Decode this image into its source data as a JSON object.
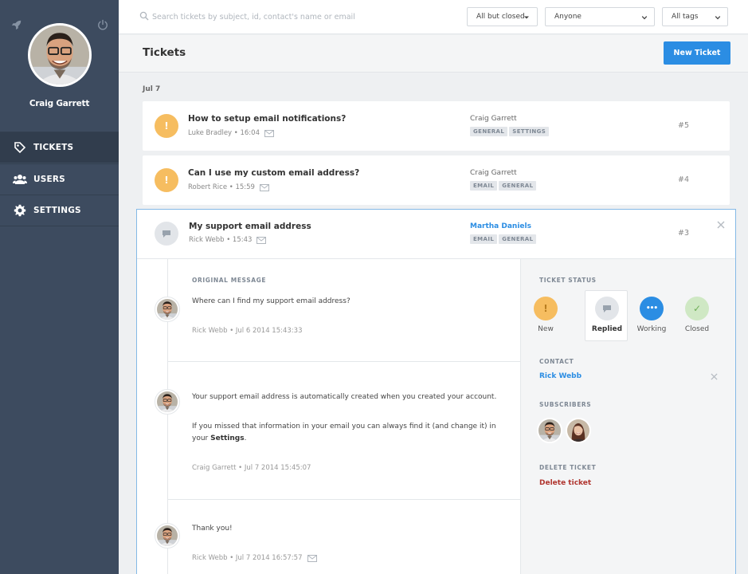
{
  "user": {
    "name": "Craig Garrett"
  },
  "nav": [
    {
      "label": "TICKETS",
      "icon": "tag-icon"
    },
    {
      "label": "USERS",
      "icon": "users-icon"
    },
    {
      "label": "SETTINGS",
      "icon": "gear-icon"
    }
  ],
  "search": {
    "placeholder": "Search tickets by subject, id, contact's name or email"
  },
  "filters": {
    "status": "All but closed",
    "assignee": "Anyone",
    "tags": "All tags"
  },
  "header": {
    "title": "Tickets",
    "new_ticket_label": "New Ticket"
  },
  "date_group": "Jul 7",
  "tickets": [
    {
      "title": "How to setup email notifications?",
      "meta": "Luke Bradley • 16:04",
      "assignee": "Craig Garrett",
      "tags": [
        "GENERAL",
        "SETTINGS"
      ],
      "number": "#5",
      "status": "!"
    },
    {
      "title": "Can I use my custom email address?",
      "meta": "Robert Rice • 15:59",
      "assignee": "Craig Garrett",
      "tags": [
        "EMAIL",
        "GENERAL"
      ],
      "number": "#4",
      "status": "!"
    }
  ],
  "expanded": {
    "title": "My support email address",
    "meta": "Rick Webb • 15:43",
    "assignee": "Martha Daniels",
    "tags": [
      "EMAIL",
      "GENERAL"
    ],
    "number": "#3",
    "messages": [
      {
        "label": "ORIGINAL MESSAGE",
        "paragraphs": [
          "Where can I find my support email address?"
        ],
        "footer": "Rick Webb • Jul 6 2014 15:43:33"
      },
      {
        "paragraphs": [
          "Your support email address is automatically created when you created your account.",
          "If you missed that information in your email you can always find it (and change it) in your "
        ],
        "bold_word": "Settings",
        "after_bold": ".",
        "footer": "Craig Garrett • Jul 7 2014 15:45:07"
      },
      {
        "paragraphs": [
          "Thank you!"
        ],
        "footer": "Rick Webb • Jul 7 2014 16:57:57"
      }
    ],
    "side": {
      "status_label": "TICKET STATUS",
      "statuses": [
        {
          "label": "New",
          "symbol": "!",
          "color": "#f6bd60"
        },
        {
          "label": "Replied",
          "symbol": "",
          "color": "#e2e5e9"
        },
        {
          "label": "Working",
          "symbol": "•••",
          "color": "#2b8de3"
        },
        {
          "label": "Closed",
          "symbol": "✓",
          "color": "#cfe8c4"
        }
      ],
      "selected_status": "Replied",
      "contact_label": "CONTACT",
      "contact_name": "Rick Webb",
      "subscribers_label": "SUBSCRIBERS",
      "delete_label": "DELETE TICKET",
      "delete_link": "Delete ticket"
    }
  },
  "colors": {
    "accent": "#2b8de3",
    "sidebar": "#3d4b5f",
    "new": "#f6bd60",
    "danger": "#b0352f"
  }
}
